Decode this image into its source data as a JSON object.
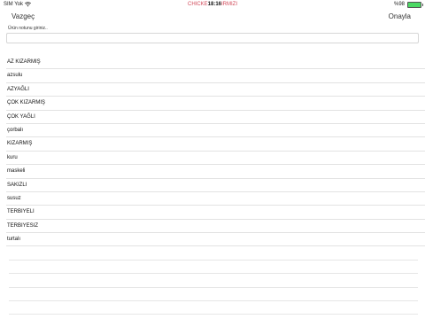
{
  "status_bar": {
    "carrier": "SIM Yok",
    "wifi_icon": "wifi-icon",
    "app_prefix": "CHICKE",
    "time": "18:16",
    "app_suffix": "IRMIZI",
    "battery_percent": "%98",
    "battery_level": 0.98,
    "battery_color": "#4cd964"
  },
  "nav": {
    "cancel_label": "Vazgeç",
    "confirm_label": "Onayla"
  },
  "note": {
    "hint": "Ürün notunu giriniz..",
    "value": ""
  },
  "options": [
    "AZ KIZARMIŞ",
    "azsulu",
    "AZYAĞLI",
    "ÇOK KIZARMIŞ",
    "ÇOK YAĞLI",
    "çorbalı",
    "KIZARMIŞ",
    "kuru",
    "maskeli",
    "SAKIZLI",
    "susuz",
    "TERBIYELI",
    "TERBIYESIZ",
    "turtalı"
  ]
}
